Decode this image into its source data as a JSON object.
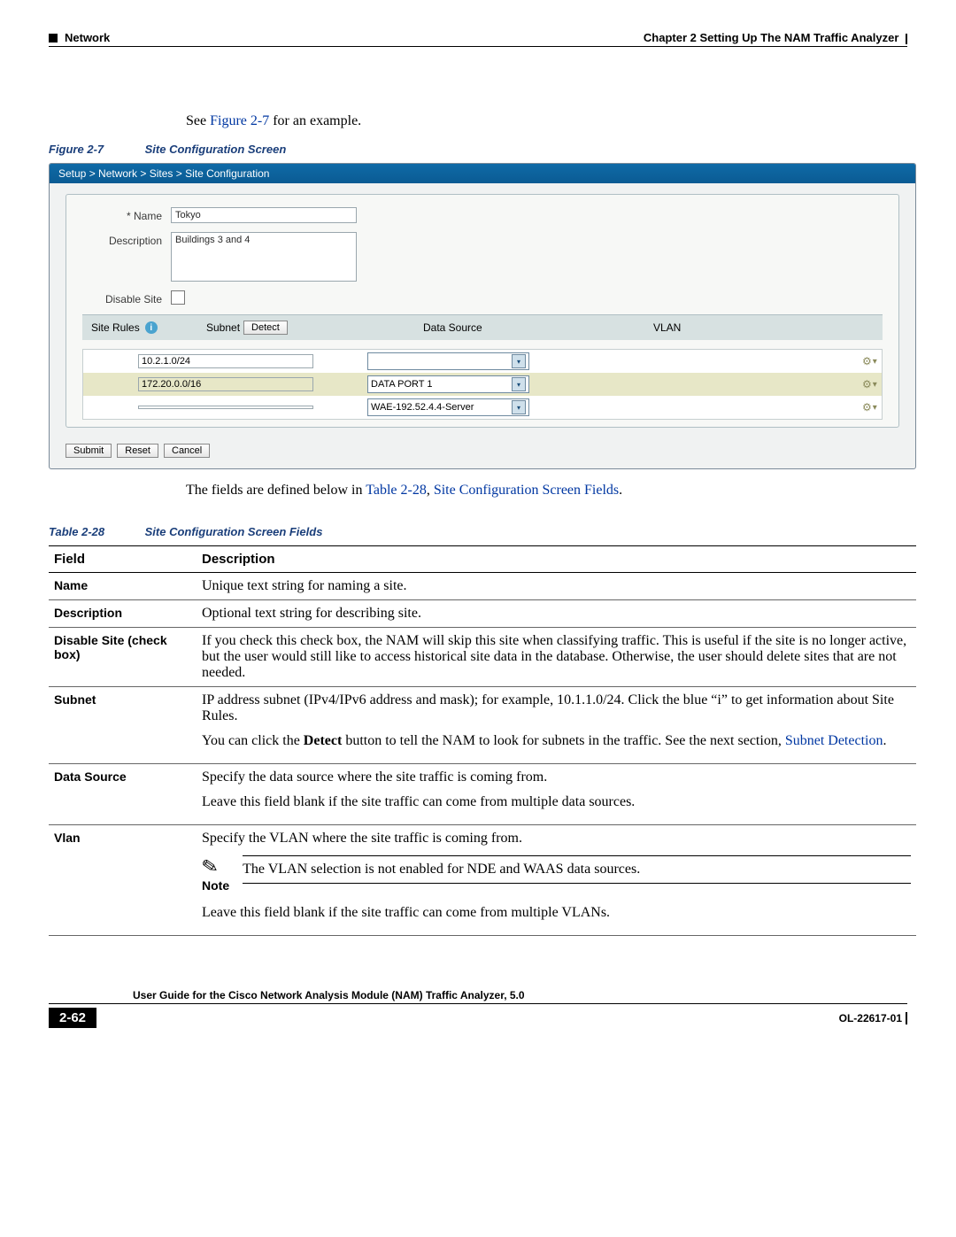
{
  "header": {
    "section": "Network",
    "chapter": "Chapter 2      Setting Up The NAM Traffic Analyzer"
  },
  "intro_pre": "See ",
  "intro_link": "Figure 2-7",
  "intro_post": " for an example.",
  "figure_caption_label": "Figure 2-7",
  "figure_caption_title": "Site Configuration Screen",
  "breadcrumb": "Setup > Network > Sites > Site Configuration",
  "form": {
    "name_label": "* Name",
    "name_value": "Tokyo",
    "desc_label": "Description",
    "desc_value": "Buildings 3 and 4",
    "disable_label": "Disable Site"
  },
  "rules": {
    "title": "Site Rules",
    "subnet_label": "Subnet",
    "detect_btn": "Detect",
    "ds_label": "Data Source",
    "vlan_label": "VLAN",
    "rows": [
      {
        "subnet": "10.2.1.0/24",
        "ds": ""
      },
      {
        "subnet": "172.20.0.0/16",
        "ds": "DATA PORT 1"
      },
      {
        "subnet": "",
        "ds": "WAE-192.52.4.4-Server"
      }
    ]
  },
  "buttons": {
    "submit": "Submit",
    "reset": "Reset",
    "cancel": "Cancel"
  },
  "after_pre": "The fields are defined below in ",
  "after_link1": "Table 2-28",
  "after_comma": ", ",
  "after_link2": "Site Configuration Screen Fields",
  "after_post": ".",
  "table_caption_label": "Table 2-28",
  "table_caption_title": "Site Configuration Screen Fields",
  "th_field": "Field",
  "th_desc": "Description",
  "rows": {
    "name": {
      "f": "Name",
      "d": "Unique text string for naming a site."
    },
    "desc": {
      "f": "Description",
      "d": "Optional text string for describing site."
    },
    "disable": {
      "f": "Disable Site (check box)",
      "d": "If you check this check box, the NAM will skip this site when classifying traffic. This is useful if the site is no longer active, but the user would still like to access historical site data in the database. Otherwise, the user should delete sites that are not needed."
    },
    "subnet": {
      "f": "Subnet",
      "p1": "IP address subnet (IPv4/IPv6 address and mask); for example, 10.1.1.0/24. Click the blue “i” to get information about Site Rules.",
      "p2a": "You can click the ",
      "p2b": "Detect",
      "p2c": " button to tell the NAM to look for subnets in the traffic. See the next section, ",
      "p2link": "Subnet Detection",
      "p2d": "."
    },
    "ds": {
      "f": "Data Source",
      "p1": "Specify the data source where the site traffic is coming from.",
      "p2": "Leave this field blank if the site traffic can come from multiple data sources."
    },
    "vlan": {
      "f": "Vlan",
      "p1": "Specify the VLAN where the site traffic is coming from.",
      "note_label": "Note",
      "note_text": "The VLAN selection is not enabled for NDE and WAAS data sources.",
      "p3": "Leave this field blank if the site traffic can come from multiple VLANs."
    }
  },
  "footer": {
    "title": "User Guide for the Cisco Network Analysis Module (NAM) Traffic Analyzer, 5.0",
    "page": "2-62",
    "docid": "OL-22617-01"
  }
}
